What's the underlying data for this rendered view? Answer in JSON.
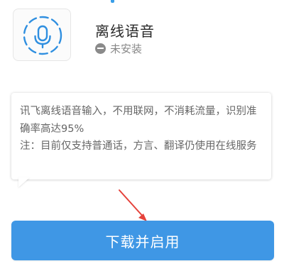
{
  "header": {
    "app_title": "离线语音",
    "status_text": "未安装"
  },
  "description": {
    "line1": "讯飞离线语音输入，不用联网，不消耗流量，识别准确率高达95%",
    "line2": "注：目前仅支持普通话，方言、翻译仍使用在线服务"
  },
  "actions": {
    "download_label": "下载并启用"
  },
  "colors": {
    "accent": "#3f97e5",
    "icon_blue": "#2f8fe0",
    "arrow": "#e5423b",
    "status_gray": "#8a8a8a"
  },
  "icons": {
    "app_icon": "microphone-icon",
    "status_icon": "minus-circle-icon"
  }
}
